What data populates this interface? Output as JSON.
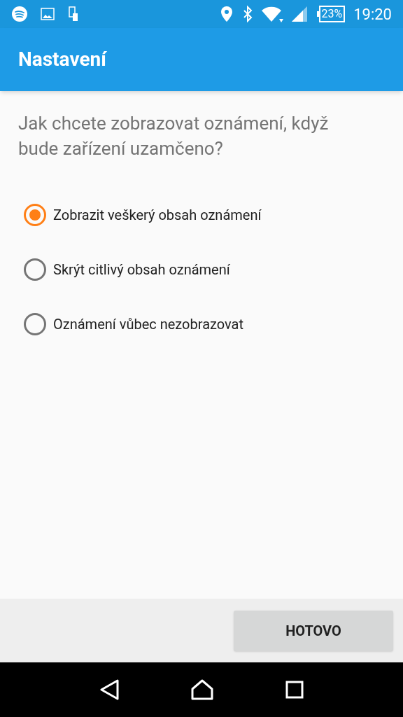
{
  "status_bar": {
    "battery": "23%",
    "time": "19:20"
  },
  "app_bar": {
    "title": "Nastavení"
  },
  "question": "Jak chcete zobrazovat oznámení, když bude zařízení uzamčeno?",
  "options": [
    {
      "label": "Zobrazit veškerý obsah oznámení",
      "selected": true
    },
    {
      "label": "Skrýt citlivý obsah oznámení",
      "selected": false
    },
    {
      "label": "Oznámení vůbec nezobrazovat",
      "selected": false
    }
  ],
  "buttons": [
    "HOTOVO"
  ]
}
